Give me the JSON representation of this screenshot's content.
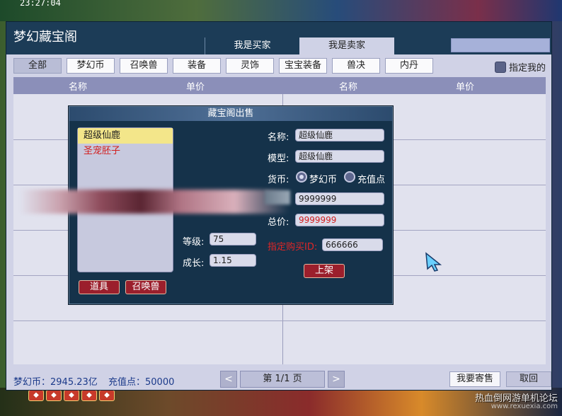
{
  "game": {
    "clock": "23:27:04",
    "watermark": "热血倒网游单机论坛",
    "watermark_url": "www.rexuexia.com"
  },
  "window": {
    "title": "梦幻藏宝阁",
    "tabs": [
      {
        "label": "我是买家",
        "active": false
      },
      {
        "label": "我是卖家",
        "active": true
      }
    ],
    "filters": [
      "全部",
      "梦幻币",
      "召唤兽",
      "装备",
      "灵饰",
      "宝宝装备",
      "兽决",
      "内丹"
    ],
    "selected_filter": "全部",
    "assign_label": "指定我的",
    "columns": [
      "名称",
      "单价",
      "名称",
      "单价"
    ],
    "footer": {
      "currency_label": "梦幻币：2945.23亿",
      "points_label": "充值点：50000",
      "page_label": "第  1/1  页",
      "prev": "<",
      "next": ">",
      "sell_button": "我要寄售",
      "cancel_button": "取回"
    }
  },
  "modal": {
    "title": "藏宝阁出售",
    "items": [
      {
        "label": "超级仙鹿",
        "selected": true
      },
      {
        "label": "圣宠胚子",
        "selected": false
      }
    ],
    "tab_buttons": [
      "道具",
      "召唤兽"
    ],
    "level_label": "等级:",
    "level_value": "75",
    "growth_label": "成长:",
    "growth_value": "1.15",
    "name_label": "名称:",
    "name_value": "超级仙鹿",
    "model_label": "模型:",
    "model_value": "超级仙鹿",
    "currency_label": "货币:",
    "currency_options": [
      "梦幻币",
      "充值点"
    ],
    "currency_selected": "梦幻币",
    "price_value": "9999999",
    "total_label": "总价:",
    "total_value": "9999999",
    "buyer_id_label": "指定购买ID:",
    "buyer_id_value": "666666",
    "list_button": "上架"
  },
  "colors": {
    "window_header": "#1c3c57",
    "panel": "#d0d2e6",
    "modal_bg": "#15324a",
    "button_red": "#9b1f2c",
    "highlight": "#f3e68a",
    "warning_text": "#e02626"
  }
}
